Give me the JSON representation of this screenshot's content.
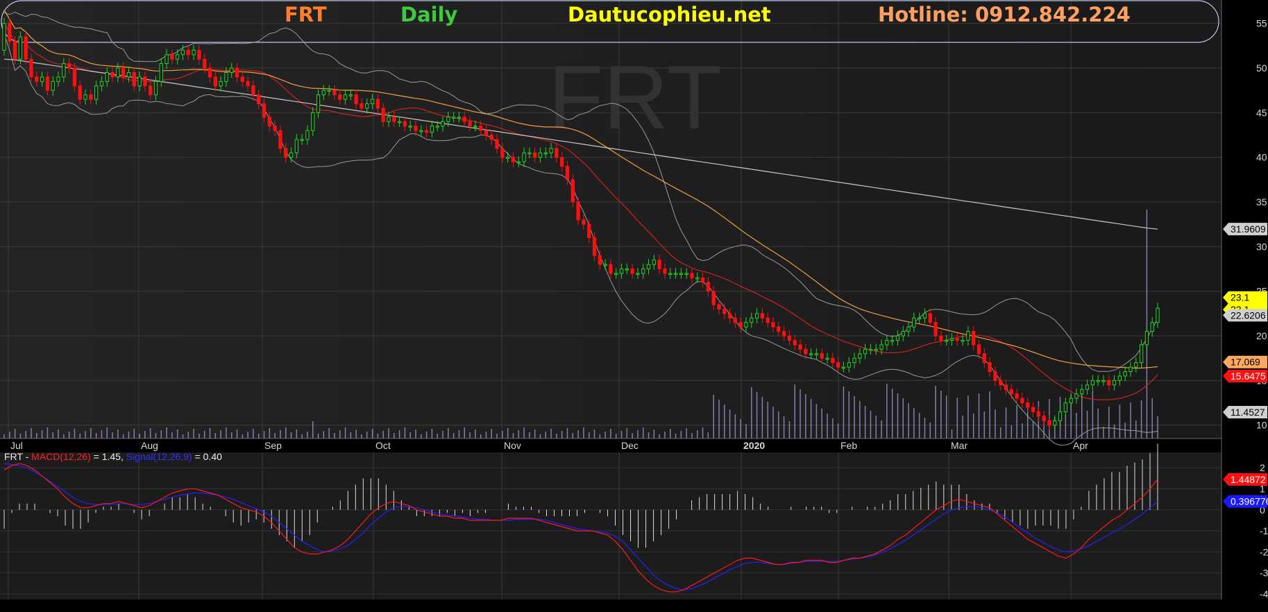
{
  "header": {
    "symbol": "FRT",
    "period": "Daily",
    "site": "Dautucophieu.net",
    "hotline": "Hotline: 0912.842.224"
  },
  "watermark": "FRT",
  "colors": {
    "symbol": "#ff7f2a",
    "period": "#3ec93e",
    "site": "#ffff00",
    "hotline": "#ffa060",
    "up": "#22d822",
    "down": "#ff1010",
    "bb": "#9a9a9a",
    "ma20": "#d22020",
    "ma50": "#f0a040",
    "ma200": "#c8c8c8",
    "macd": "#ff1a1a",
    "signal": "#2222ff",
    "hist": "#e0e0e0",
    "volume": "#9292c8"
  },
  "macd_legend": {
    "symbol": "FRT - ",
    "macd_name": "MACD(12,26)",
    "macd_value": " = 1.45, ",
    "signal_name": "Signal(12,26,9)",
    "signal_value": " = 0.40"
  },
  "chart_data": [
    {
      "type": "candlestick",
      "title": "FRT",
      "x_tick_labels": [
        "Jul",
        "Aug",
        "Sep",
        "Oct",
        "Nov",
        "Dec",
        "2020",
        "Feb",
        "Mar",
        "Apr"
      ],
      "y_ticks": [
        10,
        15,
        20,
        25,
        30,
        35,
        40,
        45,
        50,
        55
      ],
      "ylim": [
        8.5,
        57
      ],
      "grid": true,
      "last_values": {
        "close": "23.1",
        "close2": "23.1",
        "bb_upper": "22.6206",
        "ma50": "17.069",
        "ma20": "15.6475",
        "ma200": "31.9609",
        "bb_lower": "11.4527"
      },
      "close": [
        55,
        53,
        51,
        53.5,
        51,
        49,
        48.5,
        49,
        47.5,
        48.5,
        49,
        50.5,
        50,
        48,
        46.5,
        47,
        46.5,
        48,
        48.5,
        49.5,
        49,
        50,
        49,
        49.5,
        48,
        49,
        48,
        47,
        48.5,
        50.5,
        51.5,
        51,
        51.5,
        52,
        51.5,
        52,
        51,
        50,
        49,
        48,
        48.5,
        49.5,
        50,
        49,
        48.5,
        48,
        47,
        46,
        44.5,
        43.5,
        43,
        41,
        40,
        40.5,
        42,
        42,
        43,
        45,
        47,
        47.5,
        47.5,
        47,
        46.5,
        47,
        47,
        46,
        45.5,
        46,
        46.5,
        45.5,
        44,
        44.5,
        44,
        44,
        43.5,
        43.5,
        43,
        43,
        42.8,
        43.5,
        43.5,
        44,
        44.5,
        44.5,
        44.5,
        44,
        43.5,
        43.5,
        43,
        42.5,
        42,
        41,
        40,
        40,
        39.5,
        39.5,
        40.5,
        40.5,
        40,
        40.5,
        40.5,
        41,
        40,
        39,
        37.5,
        35,
        33,
        32.5,
        31,
        29,
        28,
        28,
        27,
        27,
        27.5,
        27.5,
        27,
        27,
        27.5,
        28,
        28.5,
        27.5,
        27,
        27,
        27,
        27,
        27,
        26.5,
        26.5,
        26,
        25,
        23.5,
        23,
        22.5,
        22,
        21.5,
        21,
        21.5,
        22,
        22.5,
        22,
        21.5,
        21,
        20.5,
        20,
        19.5,
        19,
        18.5,
        18,
        18,
        18,
        17.5,
        17.5,
        17,
        16.5,
        16.5,
        17,
        17.5,
        18,
        18.5,
        18.5,
        18.5,
        19,
        19.5,
        19.5,
        20,
        20.5,
        21,
        22,
        22,
        22.5,
        21.5,
        20,
        19.5,
        19.5,
        19.7,
        19.5,
        19.5,
        20.5,
        19,
        18,
        17,
        16,
        15,
        14.5,
        14,
        13.5,
        13,
        12.5,
        12,
        11.5,
        11,
        10.5,
        10,
        10.5,
        11.5,
        12.5,
        13,
        13.5,
        14,
        14.5,
        15,
        15,
        15,
        14.5,
        15,
        15.5,
        16,
        16.5,
        17,
        19,
        20.5,
        21.5,
        23.1
      ],
      "ma200": [
        51,
        50.9,
        50.7,
        50.5,
        50.3,
        50.1,
        49.9,
        49.7,
        49.5,
        49.3,
        49.1,
        48.9,
        48.7,
        48.5,
        48.3,
        48.1,
        47.9,
        47.7,
        47.5,
        47.3,
        47.1,
        46.9,
        46.7,
        46.5,
        46.3,
        46.1,
        45.9,
        45.7,
        45.5,
        45.3,
        45.1,
        44.9,
        44.7,
        44.5,
        44.3,
        44.1,
        43.9,
        43.7,
        43.5,
        43.3,
        43.1,
        42.9,
        42.7,
        42.5,
        42.3,
        42.1,
        41.9,
        41.7,
        41.5,
        41.3,
        41.1,
        40.9,
        40.7,
        40.5,
        40.3,
        40.1,
        39.9,
        39.7,
        39.5,
        39.3,
        39.1,
        38.9,
        38.7,
        38.5,
        38.3,
        38.1,
        37.9,
        37.7,
        37.5,
        37.3,
        37.1,
        36.9,
        36.7,
        36.5,
        36.3,
        36.1,
        35.9,
        35.7,
        35.5,
        35.3,
        35.1,
        34.9,
        34.7,
        34.5,
        34.3,
        34.1,
        33.9,
        33.7,
        33.5,
        33.3,
        33.1,
        32.9,
        32.7,
        32.5,
        32.3,
        32.1,
        31.9609
      ],
      "macd": [
        1.9,
        2.1,
        2.2,
        2.1,
        1.9,
        1.6,
        1.3,
        1.0,
        0.6,
        0.3,
        0.1,
        0.1,
        0.2,
        0.3,
        0.3,
        0.4,
        0.3,
        0.2,
        0.1,
        0.2,
        0.4,
        0.6,
        0.8,
        0.9,
        1.0,
        1.0,
        0.9,
        0.8,
        0.7,
        0.5,
        0.3,
        0.1,
        0.0,
        -0.1,
        -0.3,
        -0.6,
        -1.0,
        -1.4,
        -1.8,
        -2.0,
        -2.1,
        -2.1,
        -2.0,
        -1.9,
        -1.7,
        -1.4,
        -1.0,
        -0.6,
        -0.2,
        0.1,
        0.3,
        0.4,
        0.3,
        0.2,
        0.0,
        -0.1,
        -0.2,
        -0.3,
        -0.3,
        -0.4,
        -0.4,
        -0.5,
        -0.5,
        -0.5,
        -0.5,
        -0.5,
        -0.4,
        -0.4,
        -0.4,
        -0.4,
        -0.5,
        -0.6,
        -0.7,
        -0.8,
        -0.9,
        -1.0,
        -1.0,
        -1.0,
        -1.1,
        -1.2,
        -1.5,
        -1.9,
        -2.4,
        -2.9,
        -3.3,
        -3.6,
        -3.8,
        -3.9,
        -3.9,
        -3.8,
        -3.6,
        -3.4,
        -3.2,
        -3.0,
        -2.8,
        -2.6,
        -2.4,
        -2.3,
        -2.3,
        -2.4,
        -2.5,
        -2.6,
        -2.6,
        -2.5,
        -2.5,
        -2.4,
        -2.4,
        -2.4,
        -2.5,
        -2.5,
        -2.4,
        -2.3,
        -2.3,
        -2.2,
        -2.1,
        -1.9,
        -1.7,
        -1.4,
        -1.2,
        -0.9,
        -0.6,
        -0.3,
        0.0,
        0.2,
        0.4,
        0.5,
        0.4,
        0.3,
        0.2,
        0.1,
        -0.2,
        -0.5,
        -0.8,
        -1.1,
        -1.4,
        -1.6,
        -1.8,
        -2.0,
        -2.2,
        -2.3,
        -2.1,
        -1.8,
        -1.4,
        -1.1,
        -0.8,
        -0.5,
        -0.3,
        0.0,
        0.3,
        0.6,
        1.0,
        1.45
      ],
      "signal": [
        2.2,
        2.15,
        2.1,
        2.0,
        1.8,
        1.6,
        1.35,
        1.1,
        0.85,
        0.6,
        0.4,
        0.3,
        0.25,
        0.25,
        0.25,
        0.3,
        0.3,
        0.25,
        0.25,
        0.3,
        0.4,
        0.5,
        0.6,
        0.7,
        0.75,
        0.8,
        0.8,
        0.75,
        0.7,
        0.6,
        0.5,
        0.35,
        0.2,
        0.05,
        -0.1,
        -0.3,
        -0.6,
        -0.9,
        -1.2,
        -1.5,
        -1.7,
        -1.9,
        -2.0,
        -1.95,
        -1.85,
        -1.7,
        -1.4,
        -1.1,
        -0.7,
        -0.4,
        -0.1,
        0.1,
        0.15,
        0.15,
        0.1,
        0.0,
        -0.1,
        -0.2,
        -0.25,
        -0.3,
        -0.35,
        -0.4,
        -0.45,
        -0.45,
        -0.5,
        -0.5,
        -0.5,
        -0.45,
        -0.45,
        -0.45,
        -0.45,
        -0.5,
        -0.6,
        -0.7,
        -0.8,
        -0.9,
        -0.95,
        -1.0,
        -1.05,
        -1.1,
        -1.25,
        -1.5,
        -1.9,
        -2.3,
        -2.7,
        -3.1,
        -3.4,
        -3.6,
        -3.75,
        -3.8,
        -3.75,
        -3.6,
        -3.45,
        -3.25,
        -3.05,
        -2.85,
        -2.7,
        -2.55,
        -2.5,
        -2.5,
        -2.55,
        -2.6,
        -2.6,
        -2.55,
        -2.5,
        -2.45,
        -2.45,
        -2.45,
        -2.45,
        -2.45,
        -2.4,
        -2.35,
        -2.3,
        -2.25,
        -2.15,
        -2.0,
        -1.85,
        -1.65,
        -1.45,
        -1.2,
        -0.95,
        -0.7,
        -0.45,
        -0.2,
        0.0,
        0.1,
        0.15,
        0.15,
        0.1,
        0.0,
        -0.15,
        -0.35,
        -0.6,
        -0.85,
        -1.1,
        -1.35,
        -1.55,
        -1.75,
        -1.9,
        -2.0,
        -1.95,
        -1.85,
        -1.7,
        -1.5,
        -1.3,
        -1.1,
        -0.9,
        -0.7,
        -0.45,
        -0.2,
        0.1,
        0.4
      ],
      "macd_y_ticks": [
        -4,
        -3,
        -2,
        -1,
        0,
        1,
        2
      ],
      "macd_last": {
        "macd": "1.44872",
        "signal": "0.396776"
      }
    }
  ]
}
